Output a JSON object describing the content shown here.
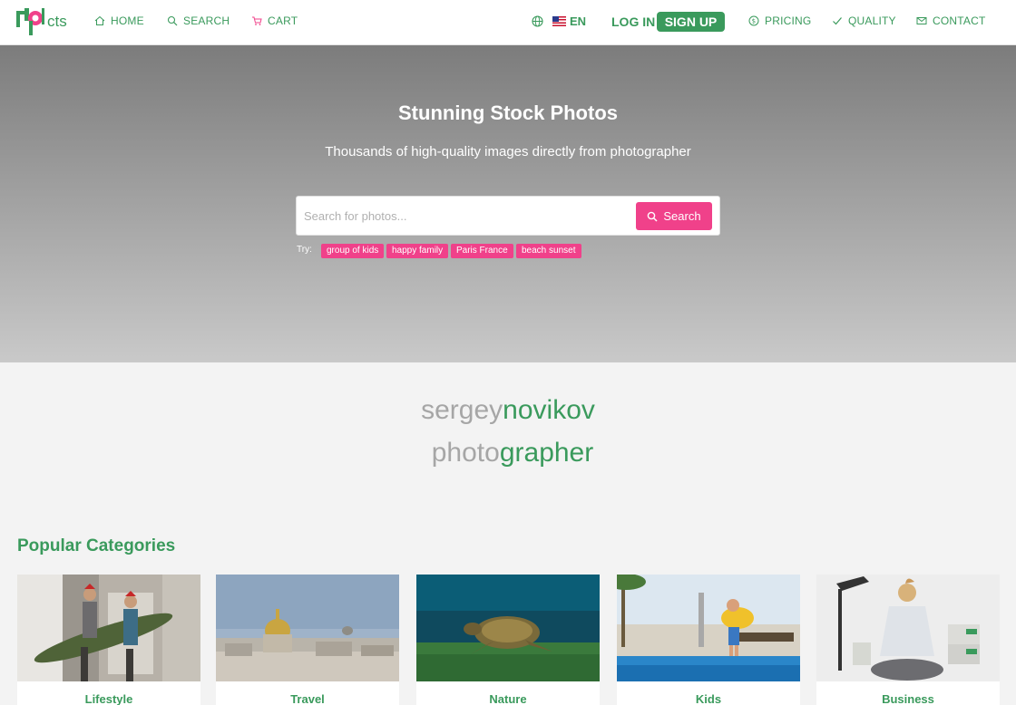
{
  "header": {
    "logo_text": "pcts",
    "nav": {
      "home": "HOME",
      "search": "SEARCH",
      "cart": "CART",
      "pricing": "PRICING",
      "quality": "QUALITY",
      "contact": "CONTACT"
    },
    "language": "EN",
    "login": "LOG IN",
    "signup": "SIGN UP"
  },
  "hero": {
    "title": "Stunning Stock Photos",
    "subtitle": "Thousands of high-quality images directly from photographer",
    "search_placeholder": "Search for photos...",
    "search_button": "Search",
    "try_label": "Try:",
    "suggestions": [
      "group of kids",
      "happy family",
      "Paris France",
      "beach sunset"
    ]
  },
  "brand": {
    "line1_grey": "sergey",
    "line1_green": "novikov",
    "line2_grey": "photo",
    "line2_green": "grapher"
  },
  "categories": {
    "title": "Popular Categories",
    "items": [
      "Lifestyle",
      "Travel",
      "Nature",
      "Kids",
      "Business"
    ]
  },
  "colors": {
    "accent_green": "#3a9a5c",
    "accent_pink": "#f0418a"
  }
}
